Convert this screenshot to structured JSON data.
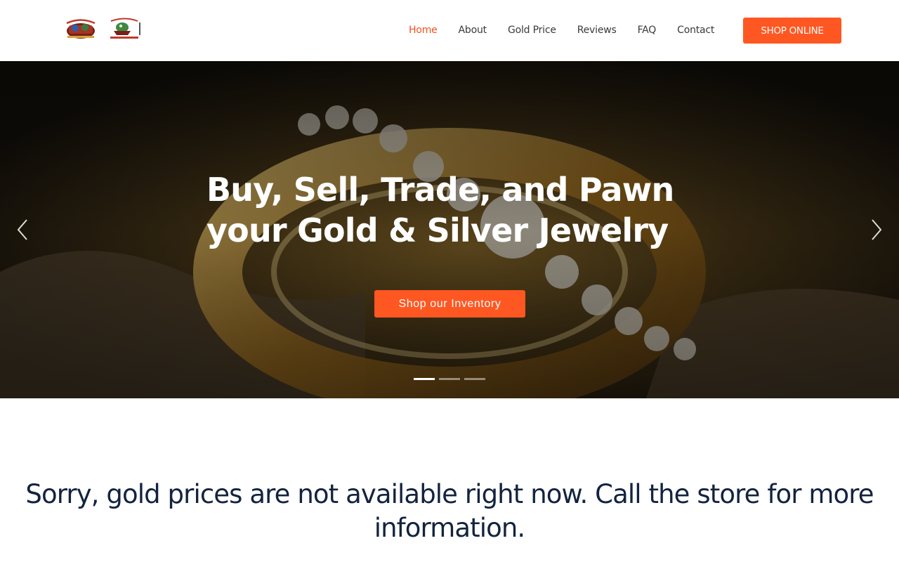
{
  "header": {
    "nav": [
      {
        "label": "Home",
        "active": true
      },
      {
        "label": "About",
        "active": false
      },
      {
        "label": "Gold Price",
        "active": false
      },
      {
        "label": "Reviews",
        "active": false
      },
      {
        "label": "FAQ",
        "active": false
      },
      {
        "label": "Contact",
        "active": false
      }
    ],
    "shop_online_label": "SHOP ONLINE"
  },
  "hero": {
    "title_line1": "Buy, Sell, Trade, and Pawn",
    "title_line2": "your Gold & Silver Jewelry",
    "cta_label": "Shop our Inventory",
    "slide_count": 3,
    "active_slide": 1
  },
  "notice": {
    "text": "Sorry, gold prices are not available right now. Call the store for more information."
  },
  "colors": {
    "accent": "#ff5722",
    "nav_active": "#f4511e",
    "notice_text": "#13233f"
  },
  "icons": {
    "prev": "chevron-left-icon",
    "next": "chevron-right-icon"
  }
}
